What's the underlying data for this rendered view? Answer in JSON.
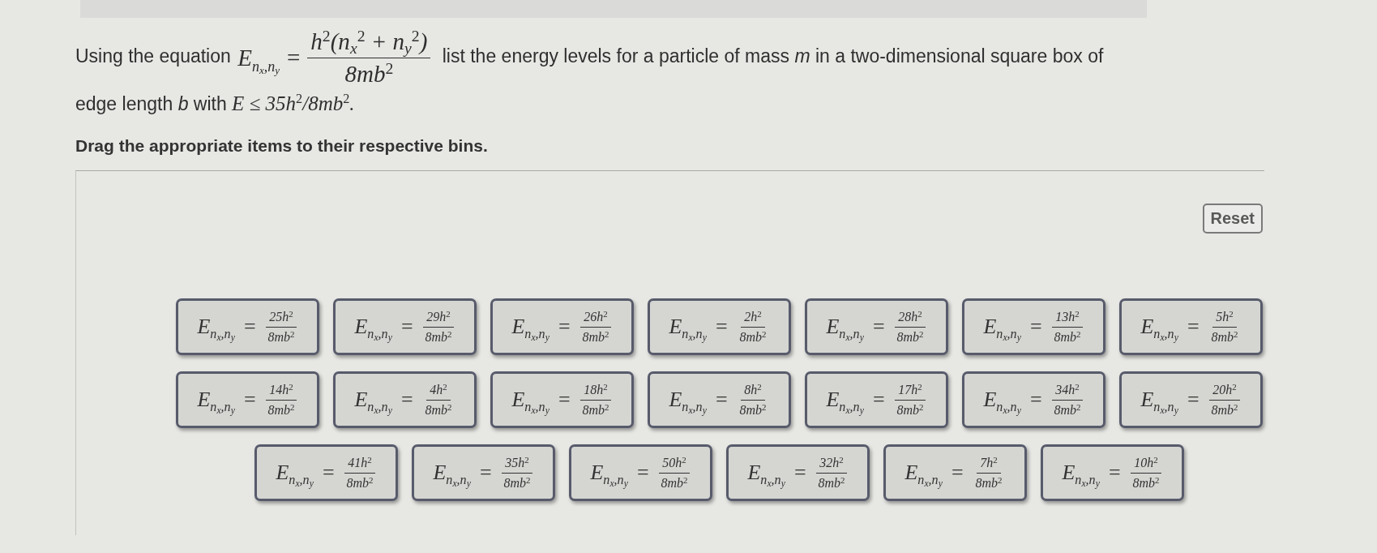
{
  "question": {
    "lead": "Using the equation",
    "equation": {
      "lhs": "E$_{n}$$_{x}$$_{,n}$$_{y}$",
      "relation": "=",
      "numerator": "h$^{2}$(n$_{x}$$^{2}$ + n$_{y}$$^{2}$)",
      "denominator": "8mb$^{2}$"
    },
    "text": "list the energy levels for a particle of mass *m* in a two-dimensional square box of edge length *b* with",
    "condition": "E ≤ 35h$^{2}$/8mb$^{2}$."
  },
  "instruction": "Drag the appropriate items to their respective bins.",
  "reset_button": "Reset",
  "items": [
    {
      "lhs": "E$_{n}$$_{x}$$_{,n}$$_{y}$",
      "relation": "=",
      "numerator": "25h$^{2}$",
      "denominator": "8mb$^{2}$"
    },
    {
      "lhs": "E$_{n}$$_{x}$$_{,n}$$_{y}$",
      "relation": "=",
      "numerator": "29h$^{2}$",
      "denominator": "8mb$^{2}$"
    },
    {
      "lhs": "E$_{n}$$_{x}$$_{,n}$$_{y}$",
      "relation": "=",
      "numerator": "26h$^{2}$",
      "denominator": "8mb$^{2}$"
    },
    {
      "lhs": "E$_{n}$$_{x}$$_{,n}$$_{y}$",
      "relation": "=",
      "numerator": "2h$^{2}$",
      "denominator": "8mb$^{2}$"
    },
    {
      "lhs": "E$_{n}$$_{x}$$_{,n}$$_{y}$",
      "relation": "=",
      "numerator": "28h$^{2}$",
      "denominator": "8mb$^{2}$"
    },
    {
      "lhs": "E$_{n}$$_{x}$$_{,n}$$_{y}$",
      "relation": "=",
      "numerator": "13h$^{2}$",
      "denominator": "8mb$^{2}$"
    },
    {
      "lhs": "E$_{n}$$_{x}$$_{,n}$$_{y}$",
      "relation": "=",
      "numerator": "5h$^{2}$",
      "denominator": "8mb$^{2}$"
    },
    {
      "lhs": "E$_{n}$$_{x}$$_{,n}$$_{y}$",
      "relation": "=",
      "numerator": "14h$^{2}$",
      "denominator": "8mb$^{2}$"
    },
    {
      "lhs": "E$_{n}$$_{x}$$_{,n}$$_{y}$",
      "relation": "=",
      "numerator": "4h$^{2}$",
      "denominator": "8mb$^{2}$"
    },
    {
      "lhs": "E$_{n}$$_{x}$$_{,n}$$_{y}$",
      "relation": "=",
      "numerator": "18h$^{2}$",
      "denominator": "8mb$^{2}$"
    },
    {
      "lhs": "E$_{n}$$_{x}$$_{,n}$$_{y}$",
      "relation": "=",
      "numerator": "8h$^{2}$",
      "denominator": "8mb$^{2}$"
    },
    {
      "lhs": "E$_{n}$$_{x}$$_{,n}$$_{y}$",
      "relation": "=",
      "numerator": "17h$^{2}$",
      "denominator": "8mb$^{2}$"
    },
    {
      "lhs": "E$_{n}$$_{x}$$_{,n}$$_{y}$",
      "relation": "=",
      "numerator": "34h$^{2}$",
      "denominator": "8mb$^{2}$"
    },
    {
      "lhs": "E$_{n}$$_{x}$$_{,n}$$_{y}$",
      "relation": "=",
      "numerator": "20h$^{2}$",
      "denominator": "8mb$^{2}$"
    },
    {
      "lhs": "E$_{n}$$_{x}$$_{,n}$$_{y}$",
      "relation": "=",
      "numerator": "41h$^{2}$",
      "denominator": "8mb$^{2}$"
    },
    {
      "lhs": "E$_{n}$$_{x}$$_{,n}$$_{y}$",
      "relation": "=",
      "numerator": "35h$^{2}$",
      "denominator": "8mb$^{2}$"
    },
    {
      "lhs": "E$_{n}$$_{x}$$_{,n}$$_{y}$",
      "relation": "=",
      "numerator": "50h$^{2}$",
      "denominator": "8mb$^{2}$"
    },
    {
      "lhs": "E$_{n}$$_{x}$$_{,n}$$_{y}$",
      "relation": "=",
      "numerator": "32h$^{2}$",
      "denominator": "8mb$^{2}$"
    },
    {
      "lhs": "E$_{n}$$_{x}$$_{,n}$$_{y}$",
      "relation": "=",
      "numerator": "7h$^{2}$",
      "denominator": "8mb$^{2}$"
    },
    {
      "lhs": "E$_{n}$$_{x}$$_{,n}$$_{y}$",
      "relation": "=",
      "numerator": "10h$^{2}$",
      "denominator": "8mb$^{2}$"
    }
  ]
}
